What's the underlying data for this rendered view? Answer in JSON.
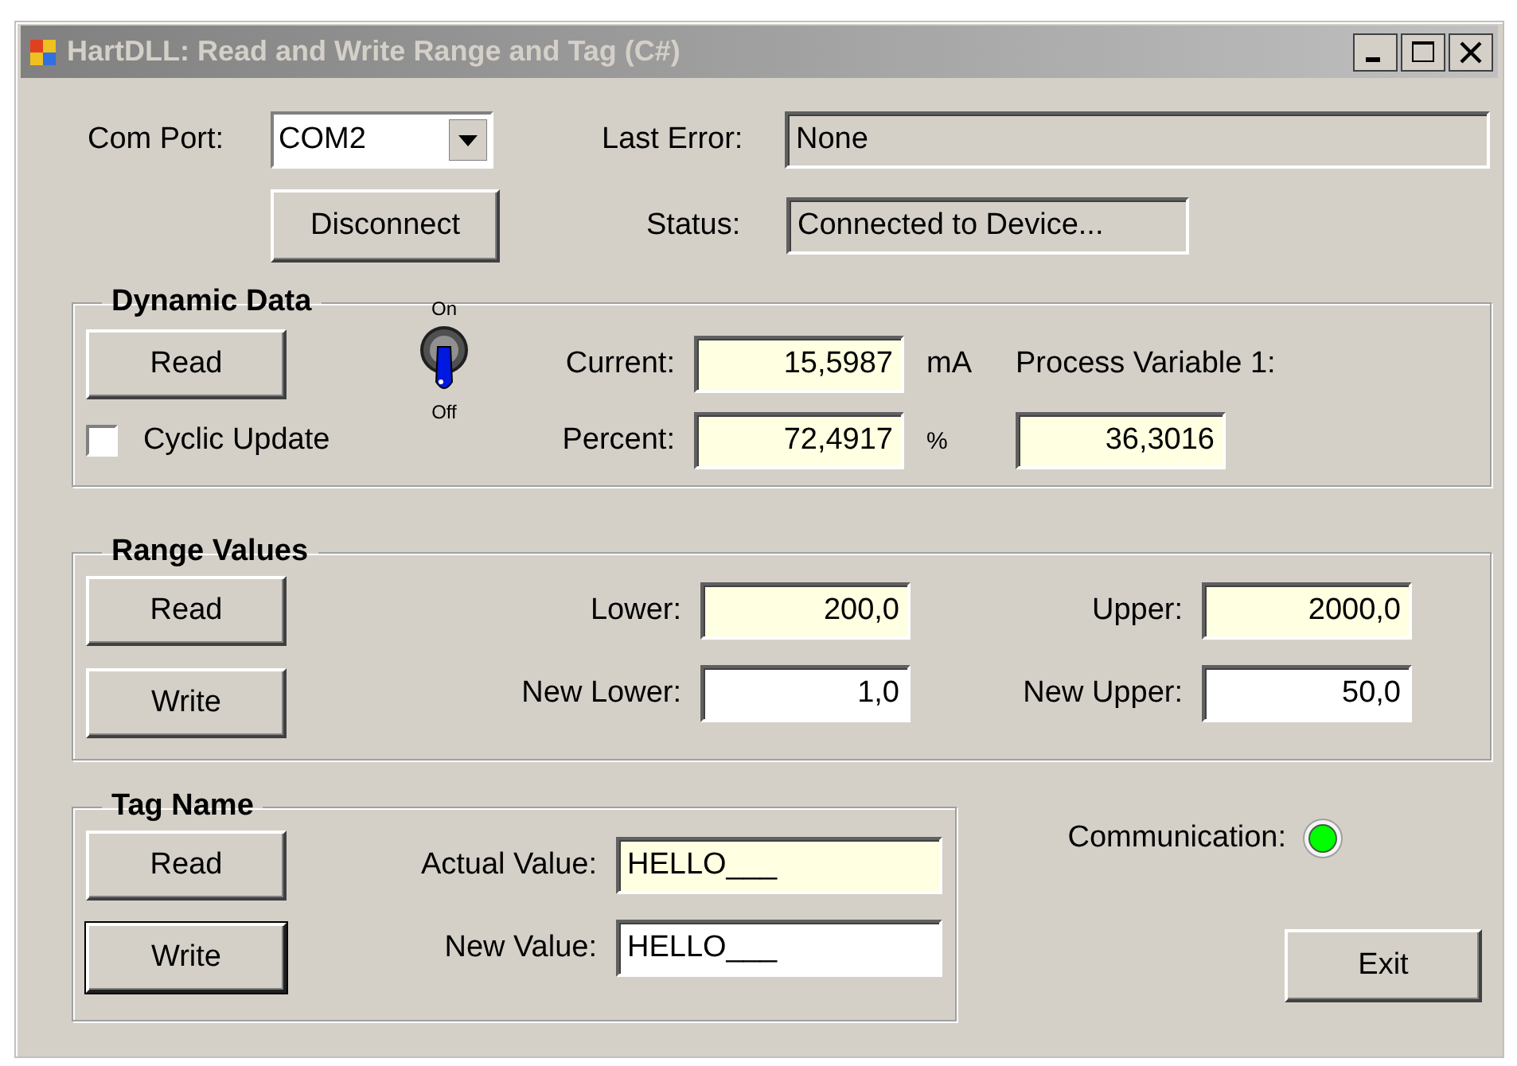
{
  "window": {
    "title": "HartDLL: Read and Write Range and Tag (C#)",
    "active": false
  },
  "com_port": {
    "label": "Com Port:",
    "value": "COM2"
  },
  "last_error": {
    "label": "Last Error:",
    "value": "None"
  },
  "disconnect_button": "Disconnect",
  "status": {
    "label": "Status:",
    "value": "Connected to Device..."
  },
  "dynamic_data": {
    "title": "Dynamic Data",
    "read_button": "Read",
    "cyclic_update": {
      "label": "Cyclic Update",
      "checked": false
    },
    "switch": {
      "on_label": "On",
      "off_label": "Off",
      "on": false
    },
    "current": {
      "label": "Current:",
      "value": "15,5987",
      "unit": "mA"
    },
    "percent": {
      "label": "Percent:",
      "value": "72,4917",
      "unit": "%"
    },
    "process_variable_1": {
      "label": "Process Variable 1:",
      "value": "36,3016"
    }
  },
  "range_values": {
    "title": "Range Values",
    "buttons": [
      {
        "label": "Read",
        "default": false
      },
      {
        "label": "Write",
        "default": false
      }
    ],
    "lower": {
      "label": "Lower:",
      "value": "200,0",
      "readonly": true
    },
    "upper": {
      "label": "Upper:",
      "value": "2000,0",
      "readonly": true
    },
    "new_lower": {
      "label": "New Lower:",
      "value": "1,0",
      "readonly": false
    },
    "new_upper": {
      "label": "New Upper:",
      "value": "50,0",
      "readonly": false
    }
  },
  "tag_name": {
    "title": "Tag Name",
    "buttons": [
      {
        "label": "Read",
        "default": false
      },
      {
        "label": "Write",
        "default": true
      }
    ],
    "actual_value": {
      "label": "Actual Value:",
      "value": "HELLO___",
      "readonly": true
    },
    "new_value": {
      "label": "New Value:",
      "value": "HELLO___",
      "readonly": false
    }
  },
  "communication": {
    "label": "Communication:",
    "color": "#00ff00"
  },
  "exit_button": "Exit"
}
